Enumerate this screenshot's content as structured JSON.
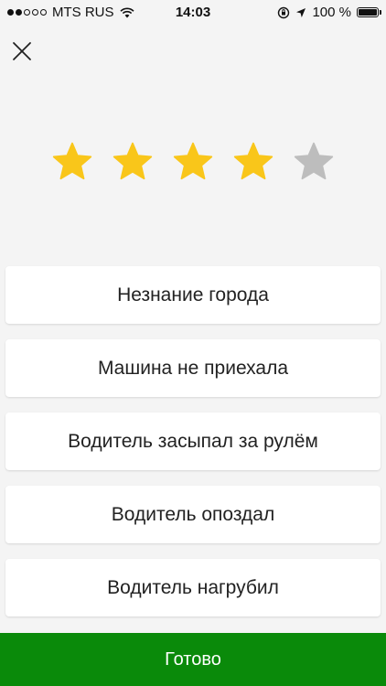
{
  "status_bar": {
    "carrier": "MTS RUS",
    "time": "14:03",
    "battery": "100 %",
    "battery_level": 1.0,
    "signal_bars_filled": 2,
    "signal_bars_total": 5
  },
  "icons": {
    "close": "close-icon",
    "star": "star-icon",
    "wifi": "wifi-icon",
    "location": "location-arrow-icon",
    "rotation_lock": "rotation-lock-icon",
    "battery": "battery-icon"
  },
  "rating": {
    "value": 4,
    "max": 5
  },
  "colors": {
    "star_filled": "#F9C61A",
    "star_empty": "#BDBDBD",
    "done_button": "#0A8A0A",
    "background": "#F4F4F4"
  },
  "reasons": [
    {
      "label": "Незнание города"
    },
    {
      "label": "Машина не приехала"
    },
    {
      "label": "Водитель засыпал за рулём"
    },
    {
      "label": "Водитель опоздал"
    },
    {
      "label": "Водитель нагрубил"
    }
  ],
  "done_button": {
    "label": "Готово"
  }
}
